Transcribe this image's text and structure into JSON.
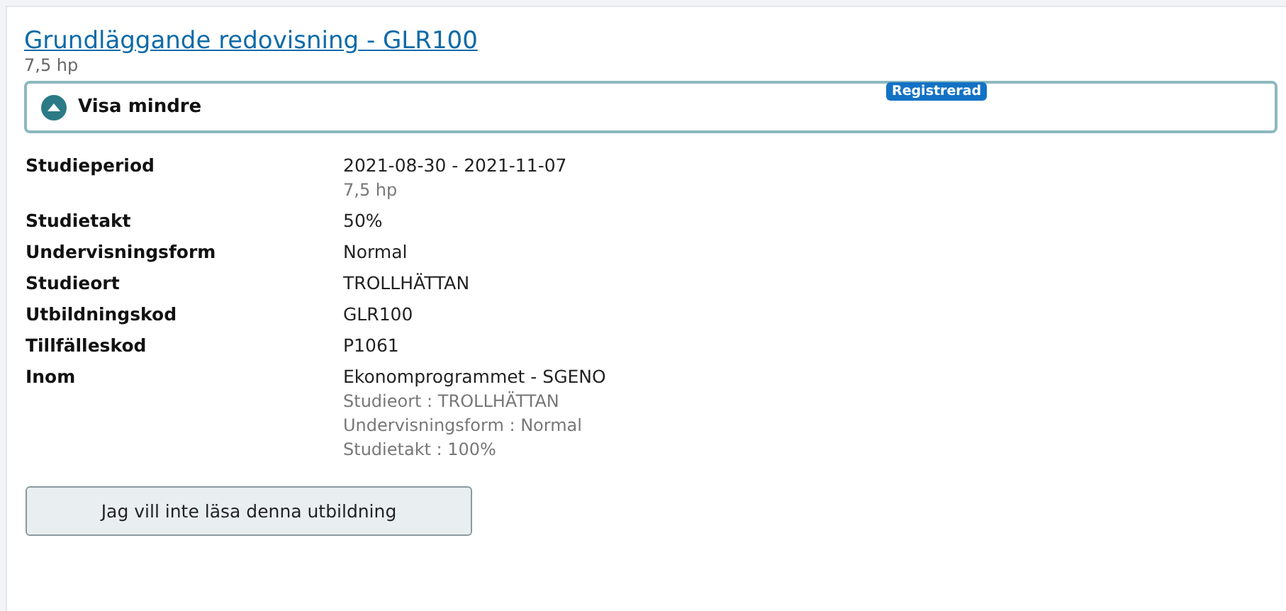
{
  "course": {
    "title": "Grundläggande redovisning - GLR100",
    "credits": "7,5 hp",
    "badge": "Registrerad"
  },
  "toggle": {
    "label": "Visa mindre",
    "expanded": true
  },
  "details": [
    {
      "label": "Studieperiod",
      "value": "2021-08-30 - 2021-11-07",
      "notes": [
        "7,5 hp"
      ]
    },
    {
      "label": "Studietakt",
      "value": "50%"
    },
    {
      "label": "Undervisningsform",
      "value": "Normal"
    },
    {
      "label": "Studieort",
      "value": "TROLLHÄTTAN"
    },
    {
      "label": "Utbildningskod",
      "value": "GLR100"
    },
    {
      "label": "Tillfälleskod",
      "value": "P1061"
    },
    {
      "label": "Inom",
      "value": "Ekonomprogrammet - SGENO",
      "notes": [
        "Studieort : TROLLHÄTTAN",
        "Undervisningsform : Normal",
        "Studietakt : 100%"
      ]
    }
  ],
  "action_button": "Jag vill inte läsa denna utbildning"
}
